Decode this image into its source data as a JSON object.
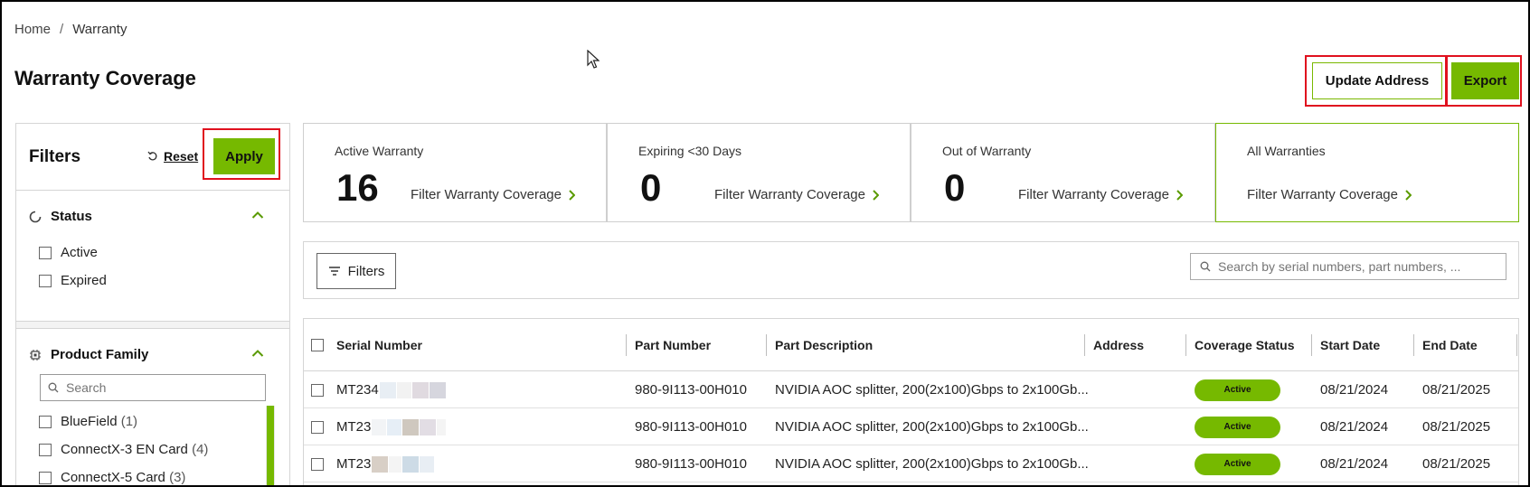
{
  "breadcrumb": {
    "home": "Home",
    "separator": "/",
    "current": "Warranty"
  },
  "page": {
    "title": "Warranty Coverage"
  },
  "actions": {
    "update_address": "Update Address",
    "export": "Export"
  },
  "colors": {
    "accent": "#76b900",
    "highlight": "#e0101e"
  },
  "sidebar": {
    "title": "Filters",
    "reset": "Reset",
    "apply": "Apply",
    "status": {
      "title": "Status",
      "icon": "spinner-icon",
      "options": [
        {
          "label": "Active"
        },
        {
          "label": "Expired"
        }
      ]
    },
    "product_family": {
      "title": "Product Family",
      "icon": "chip-icon",
      "search_placeholder": "Search",
      "options": [
        {
          "label": "BlueField",
          "count": "(1)"
        },
        {
          "label": "ConnectX-3 EN Card",
          "count": "(4)"
        },
        {
          "label": "ConnectX-5 Card",
          "count": "(3)"
        }
      ]
    }
  },
  "cards": [
    {
      "label": "Active Warranty",
      "value": "16",
      "link": "Filter Warranty Coverage"
    },
    {
      "label": "Expiring <30 Days",
      "value": "0",
      "link": "Filter Warranty Coverage"
    },
    {
      "label": "Out of Warranty",
      "value": "0",
      "link": "Filter Warranty Coverage"
    },
    {
      "label": "All Warranties",
      "value": "",
      "link": "Filter Warranty Coverage"
    }
  ],
  "toolbar": {
    "filters": "Filters",
    "search_placeholder": "Search by serial numbers, part numbers, ..."
  },
  "table": {
    "columns": [
      "Serial Number",
      "Part Number",
      "Part Description",
      "Address",
      "Coverage Status",
      "Start Date",
      "End Date"
    ],
    "rows": [
      {
        "serial": "MT234",
        "part": "980-9I113-00H010",
        "desc": "NVIDIA AOC splitter, 200(2x100)Gbps to 2x100Gb...",
        "address": "",
        "status": "Active",
        "start": "08/21/2024",
        "end": "08/21/2025"
      },
      {
        "serial": "MT23",
        "part": "980-9I113-00H010",
        "desc": "NVIDIA AOC splitter, 200(2x100)Gbps to 2x100Gb...",
        "address": "",
        "status": "Active",
        "start": "08/21/2024",
        "end": "08/21/2025"
      },
      {
        "serial": "MT23",
        "part": "980-9I113-00H010",
        "desc": "NVIDIA AOC splitter, 200(2x100)Gbps to 2x100Gb...",
        "address": "",
        "status": "Active",
        "start": "08/21/2024",
        "end": "08/21/2025"
      }
    ]
  }
}
